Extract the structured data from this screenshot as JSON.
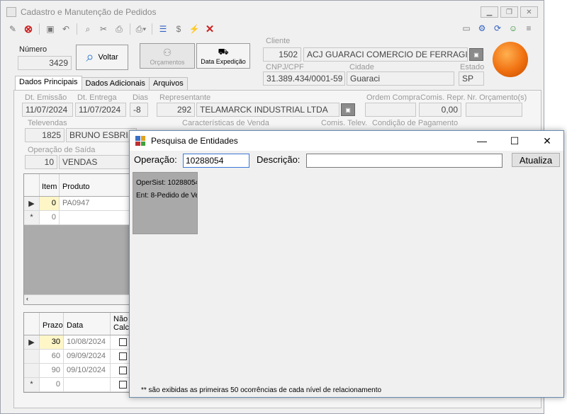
{
  "main": {
    "title": "Cadastro e Manutenção de Pedidos",
    "numero_label": "Número",
    "numero_value": "3429",
    "voltar_label": "Voltar",
    "orcamentos_label": "Orçamentos",
    "data_expedicao_label": "Data Expedição",
    "cliente_label": "Cliente",
    "cliente_code": "1502",
    "cliente_name": "ACJ GUARACI COMERCIO DE FERRAGI",
    "cnpj_label": "CNPJ/CPF",
    "cnpj_value": "31.389.434/0001-59",
    "cidade_label": "Cidade",
    "cidade_value": "Guaraci",
    "estado_label": "Estado",
    "estado_value": "SP"
  },
  "tabs": [
    "Dados Principais",
    "Dados Adicionais",
    "Arquivos"
  ],
  "form": {
    "dt_emissao_label": "Dt. Emissão",
    "dt_emissao": "11/07/2024",
    "dt_entrega_label": "Dt. Entrega",
    "dt_entrega": "11/07/2024",
    "dias_label": "Dias",
    "dias": "-8",
    "representante_label": "Representante",
    "rep_code": "292",
    "rep_name": "TELAMARCK INDUSTRIAL LTDA",
    "ordem_compra_label": "Ordem Compra",
    "comis_repr_label": "Comis. Repr.",
    "comis_repr": "0,00",
    "nr_orcamento_label": "Nr. Orçamento(s)",
    "televendas_label": "Televendas",
    "tele_code": "1825",
    "tele_name": "BRUNO ESBRI",
    "caracteristicas_label": "Características de Venda",
    "comis_telev_label": "Comis. Telev.",
    "condicao_pagamento_label": "Condição de Pagamento",
    "operacao_saida_label": "Operação de Saída",
    "op_code": "10",
    "op_name": "VENDAS"
  },
  "items_grid": {
    "headers": [
      "Item",
      "Produto"
    ],
    "rows": [
      {
        "ind": "▶",
        "item": "0",
        "produto": "PA0947"
      },
      {
        "ind": "*",
        "item": "0",
        "produto": ""
      }
    ]
  },
  "prazo_grid": {
    "headers": [
      "Prazo",
      "Data",
      "Não Calc"
    ],
    "rows": [
      {
        "ind": "▶",
        "prazo": "30",
        "data": "10/08/2024"
      },
      {
        "ind": "",
        "prazo": "60",
        "data": "09/09/2024"
      },
      {
        "ind": "",
        "prazo": "90",
        "data": "09/10/2024"
      },
      {
        "ind": "*",
        "prazo": "0",
        "data": ""
      }
    ]
  },
  "dialog": {
    "title": "Pesquisa de Entidades",
    "operacao_label": "Operação:",
    "operacao_value": "10288054",
    "descricao_label": "Descrição:",
    "descricao_value": "",
    "atualiza_label": "Atualiza",
    "tree_line1": "OperSist: 10288054",
    "tree_line2": "Ent: 8-Pedido de Ve",
    "note": "** são exibidas as primeiras 50 ocorrências de cada nível de relacionamento"
  }
}
